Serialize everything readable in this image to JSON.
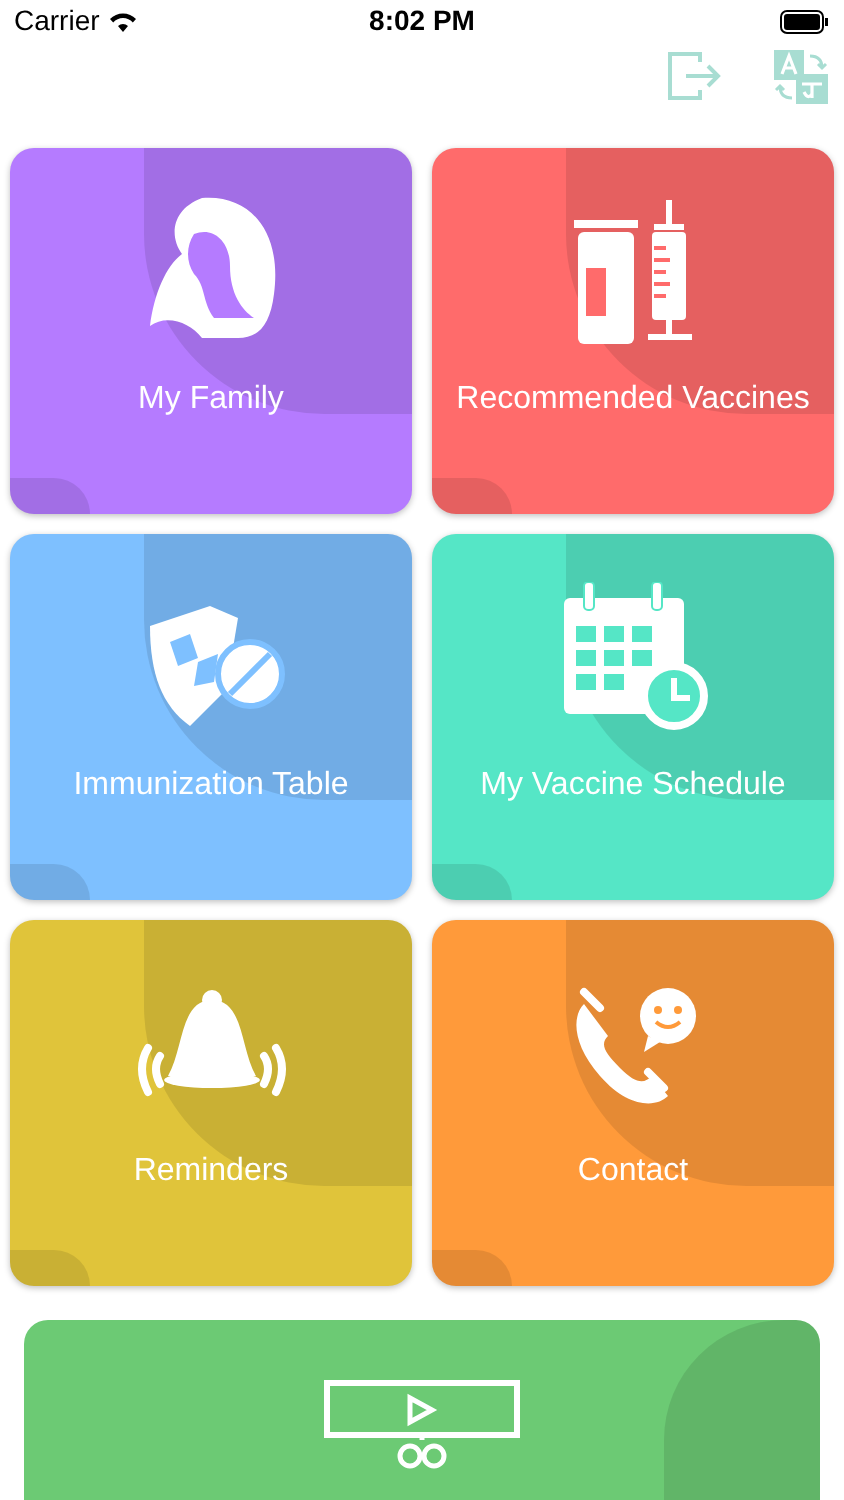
{
  "status_bar": {
    "carrier": "Carrier",
    "time": "8:02 PM"
  },
  "tiles": [
    {
      "label": "My Family",
      "color": "#b57bff"
    },
    {
      "label": "Recommended Vaccines",
      "color": "#ff6b6b"
    },
    {
      "label": "Immunization Table",
      "color": "#7ec0ff"
    },
    {
      "label": "My Vaccine Schedule",
      "color": "#55e6c6"
    },
    {
      "label": "Reminders",
      "color": "#e0c43a"
    },
    {
      "label": "Contact",
      "color": "#ff9a3a"
    }
  ],
  "bottom_tile": {
    "color": "#6cca74"
  }
}
